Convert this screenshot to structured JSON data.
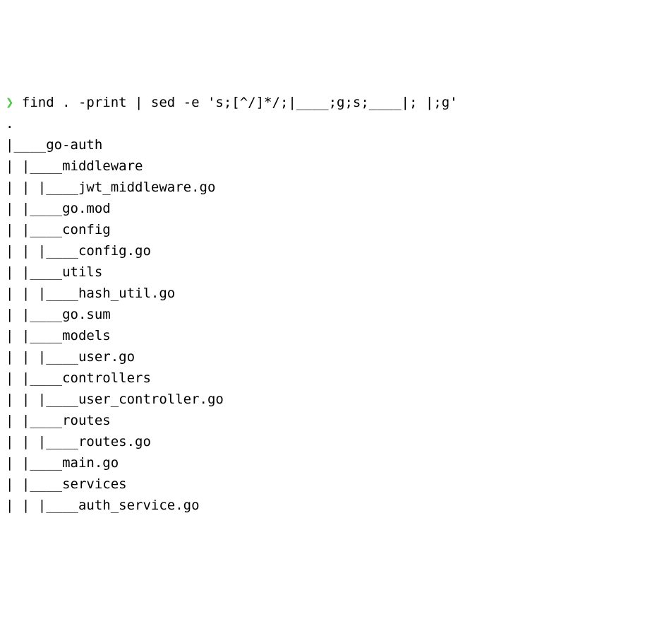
{
  "prompt": "❯",
  "command": " find . -print | sed -e 's;[^/]*/;|____;g;s;____|; |;g'",
  "output_lines": [
    ".",
    "|____go-auth",
    "| |____middleware",
    "| | |____jwt_middleware.go",
    "| |____go.mod",
    "| |____config",
    "| | |____config.go",
    "| |____utils",
    "| | |____hash_util.go",
    "| |____go.sum",
    "| |____models",
    "| | |____user.go",
    "| |____controllers",
    "| | |____user_controller.go",
    "| |____routes",
    "| | |____routes.go",
    "| |____main.go",
    "| |____services",
    "| | |____auth_service.go"
  ]
}
